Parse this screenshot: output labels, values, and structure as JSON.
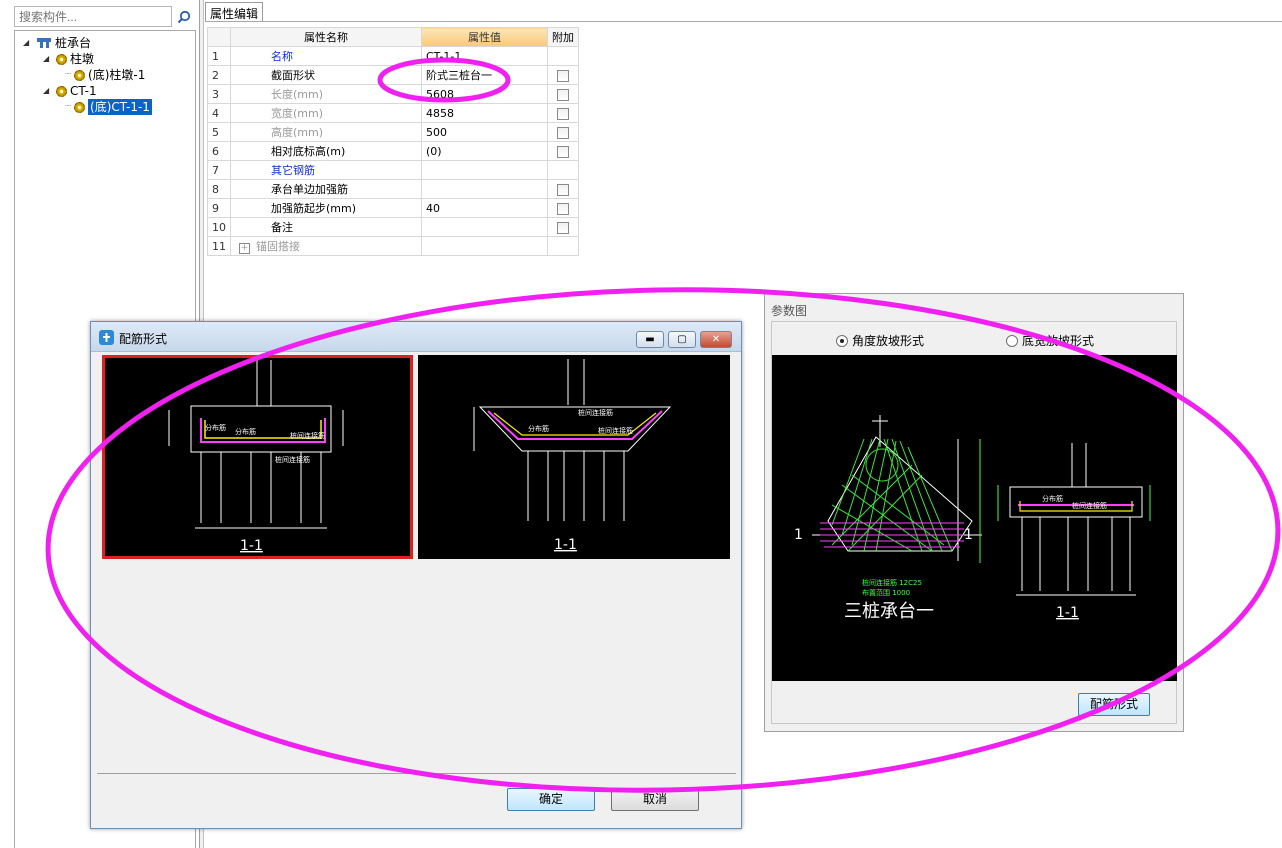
{
  "search": {
    "placeholder": "搜索构件..."
  },
  "tree": [
    {
      "label": "桩承台",
      "level": 0,
      "icon": "pile-cap-icon"
    },
    {
      "label": "柱墩",
      "level": 1,
      "icon": "gear-icon"
    },
    {
      "label": "(底)柱墩-1",
      "level": 2,
      "icon": "gear-icon"
    },
    {
      "label": "CT-1",
      "level": 1,
      "icon": "gear-icon"
    },
    {
      "label": "(底)CT-1-1",
      "level": 2,
      "icon": "gear-icon",
      "selected": true
    }
  ],
  "property_tab": "属性编辑",
  "table": {
    "headers": [
      "属性名称",
      "属性值",
      "附加"
    ],
    "rows": [
      {
        "num": "1",
        "name": "名称",
        "value": "CT-1-1",
        "style": "blue",
        "checkbox": false
      },
      {
        "num": "2",
        "name": "截面形状",
        "value": "阶式三桩台一",
        "style": "normal",
        "checkbox": true
      },
      {
        "num": "3",
        "name": "长度(mm)",
        "value": "5608",
        "style": "gray",
        "checkbox": true
      },
      {
        "num": "4",
        "name": "宽度(mm)",
        "value": "4858",
        "style": "gray",
        "checkbox": true
      },
      {
        "num": "5",
        "name": "高度(mm)",
        "value": "500",
        "style": "gray",
        "checkbox": true
      },
      {
        "num": "6",
        "name": "相对底标高(m)",
        "value": "(0)",
        "style": "normal",
        "checkbox": true
      },
      {
        "num": "7",
        "name": "其它钢筋",
        "value": "",
        "style": "blue",
        "checkbox": false
      },
      {
        "num": "8",
        "name": "承台单边加强筋",
        "value": "",
        "style": "normal",
        "checkbox": true
      },
      {
        "num": "9",
        "name": "加强筋起步(mm)",
        "value": "40",
        "style": "normal",
        "checkbox": true
      },
      {
        "num": "10",
        "name": "备注",
        "value": "",
        "style": "normal",
        "checkbox": true
      },
      {
        "num": "11",
        "name": "锚固搭接",
        "value": "",
        "style": "gray",
        "checkbox": false,
        "expand": "+"
      }
    ]
  },
  "dialog_rebar": {
    "title": "配筋形式",
    "ok": "确定",
    "cancel": "取消",
    "preview1": {
      "section": "1-1",
      "labels": [
        "分布筋",
        "分布筋",
        "桩间连接筋",
        "桩间连接筋",
        "分布筋钢筋",
        "桩间连接筋"
      ]
    },
    "preview2": {
      "section": "1-1",
      "labels": [
        "桩间连接筋",
        "桩间连接筋",
        "分布筋"
      ]
    }
  },
  "dialog_param": {
    "title": "参数图",
    "radio1": "角度放坡形式",
    "radio2": "底宽放坡形式",
    "caption": "三桩承台一",
    "section": "1-1",
    "button": "配筋形式",
    "cad_labels": [
      "桩间连接筋",
      "分布筋",
      "桩间连接筋 12C25",
      "布置范围 1000"
    ]
  },
  "colors": {
    "annotation": "#f020f0",
    "selection": "#0a64c8",
    "cad_bg": "#000000",
    "cad_green": "#40ff40",
    "cad_magenta": "#ff40ff"
  }
}
